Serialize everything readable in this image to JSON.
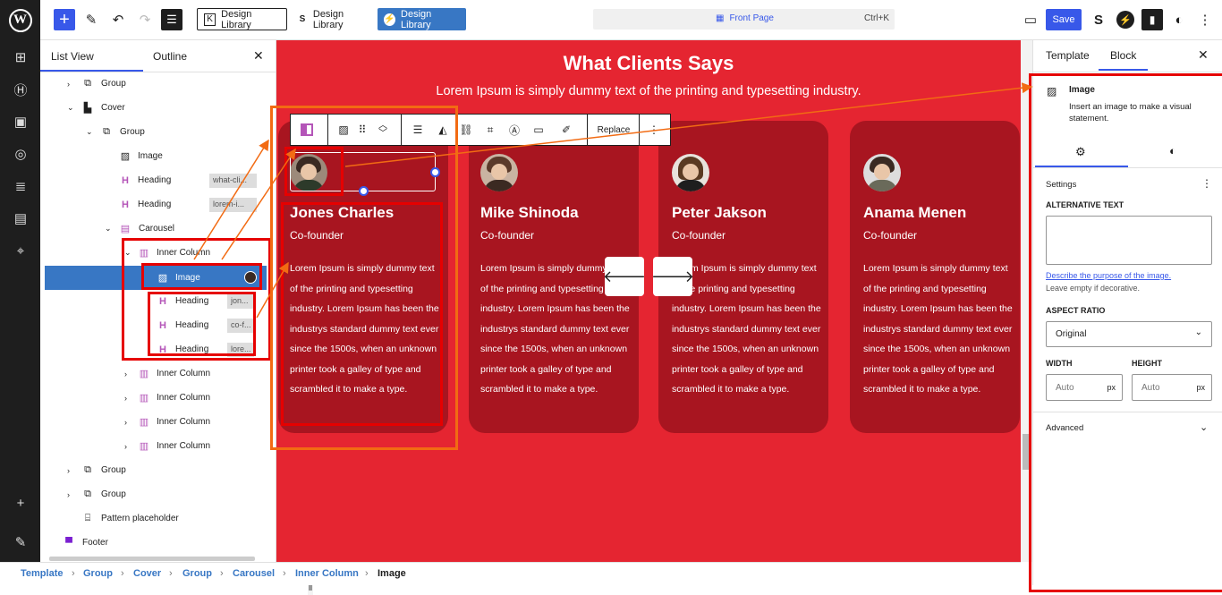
{
  "topbar": {
    "design_library_1": "Design Library",
    "design_library_2": "Design Library",
    "design_library_3": "Design Library",
    "command": "Front Page",
    "shortcut": "Ctrl+K",
    "save": "Save"
  },
  "list_panel": {
    "tab_list": "List View",
    "tab_outline": "Outline",
    "rows": [
      {
        "label": "Group"
      },
      {
        "label": "Cover"
      },
      {
        "label": "Group"
      },
      {
        "label": "Image"
      },
      {
        "label": "Heading",
        "tag": "what-cli..."
      },
      {
        "label": "Heading",
        "tag": "lorem-i..."
      },
      {
        "label": "Carousel"
      },
      {
        "label": "Inner Column"
      },
      {
        "label": "Image"
      },
      {
        "label": "Heading",
        "tag": "jon..."
      },
      {
        "label": "Heading",
        "tag": "co-f..."
      },
      {
        "label": "Heading",
        "tag": "lore..."
      },
      {
        "label": "Inner Column"
      },
      {
        "label": "Inner Column"
      },
      {
        "label": "Inner Column"
      },
      {
        "label": "Inner Column"
      },
      {
        "label": "Group"
      },
      {
        "label": "Group"
      },
      {
        "label": "Pattern placeholder"
      },
      {
        "label": "Footer"
      }
    ]
  },
  "canvas": {
    "title": "What Clients Says",
    "subtitle": "Lorem Ipsum is simply dummy text of the printing and typesetting industry.",
    "cards": [
      {
        "name": "Jones Charles",
        "role": "Co-founder",
        "text": "Lorem Ipsum is simply dummy text of the printing and typesetting industry. Lorem Ipsum has been the industrys standard dummy text ever since the 1500s, when an unknown printer took a galley of type and scrambled it to make a type."
      },
      {
        "name": "Mike Shinoda",
        "role": "Co-founder",
        "text": "Lorem Ipsum is simply dummy text of the printing and typesetting industry. Lorem Ipsum has been the industrys standard dummy text ever since the 1500s, when an unknown printer took a galley of type and scrambled it to make a type."
      },
      {
        "name": "Peter Jakson",
        "role": "Co-founder",
        "text": "Lorem Ipsum is simply dummy text of the printing and typesetting industry. Lorem Ipsum has been the industrys standard dummy text ever since the 1500s, when an unknown printer took a galley of type and scrambled it to make a type."
      },
      {
        "name": "Anama Menen",
        "role": "Co-founder",
        "text": "Lorem Ipsum is simply dummy text of the printing and typesetting industry. Lorem Ipsum has been the industrys standard dummy text ever since the 1500s, when an unknown printer took a galley of type and scrambled it to make a type."
      }
    ],
    "toolbar_replace": "Replace"
  },
  "right_panel": {
    "tab_template": "Template",
    "tab_block": "Block",
    "block_name": "Image",
    "block_desc": "Insert an image to make a visual statement.",
    "settings": "Settings",
    "alt_label": "ALTERNATIVE TEXT",
    "alt_link": "Describe the purpose of the image.",
    "alt_help": "Leave empty if decorative.",
    "aspect_label": "ASPECT RATIO",
    "aspect_value": "Original",
    "width_label": "WIDTH",
    "height_label": "HEIGHT",
    "width_placeholder": "Auto",
    "height_placeholder": "Auto",
    "unit": "px",
    "advanced": "Advanced"
  },
  "breadcrumb": [
    "Template",
    "Group",
    "Cover",
    "Group",
    "Carousel",
    "Inner Column",
    "Image"
  ],
  "colors": {
    "accent": "#3858e9",
    "canvas_bg": "#e52531",
    "card_bg": "#a81520",
    "annotation_red": "#e60000",
    "annotation_orange": "#f26b13"
  }
}
